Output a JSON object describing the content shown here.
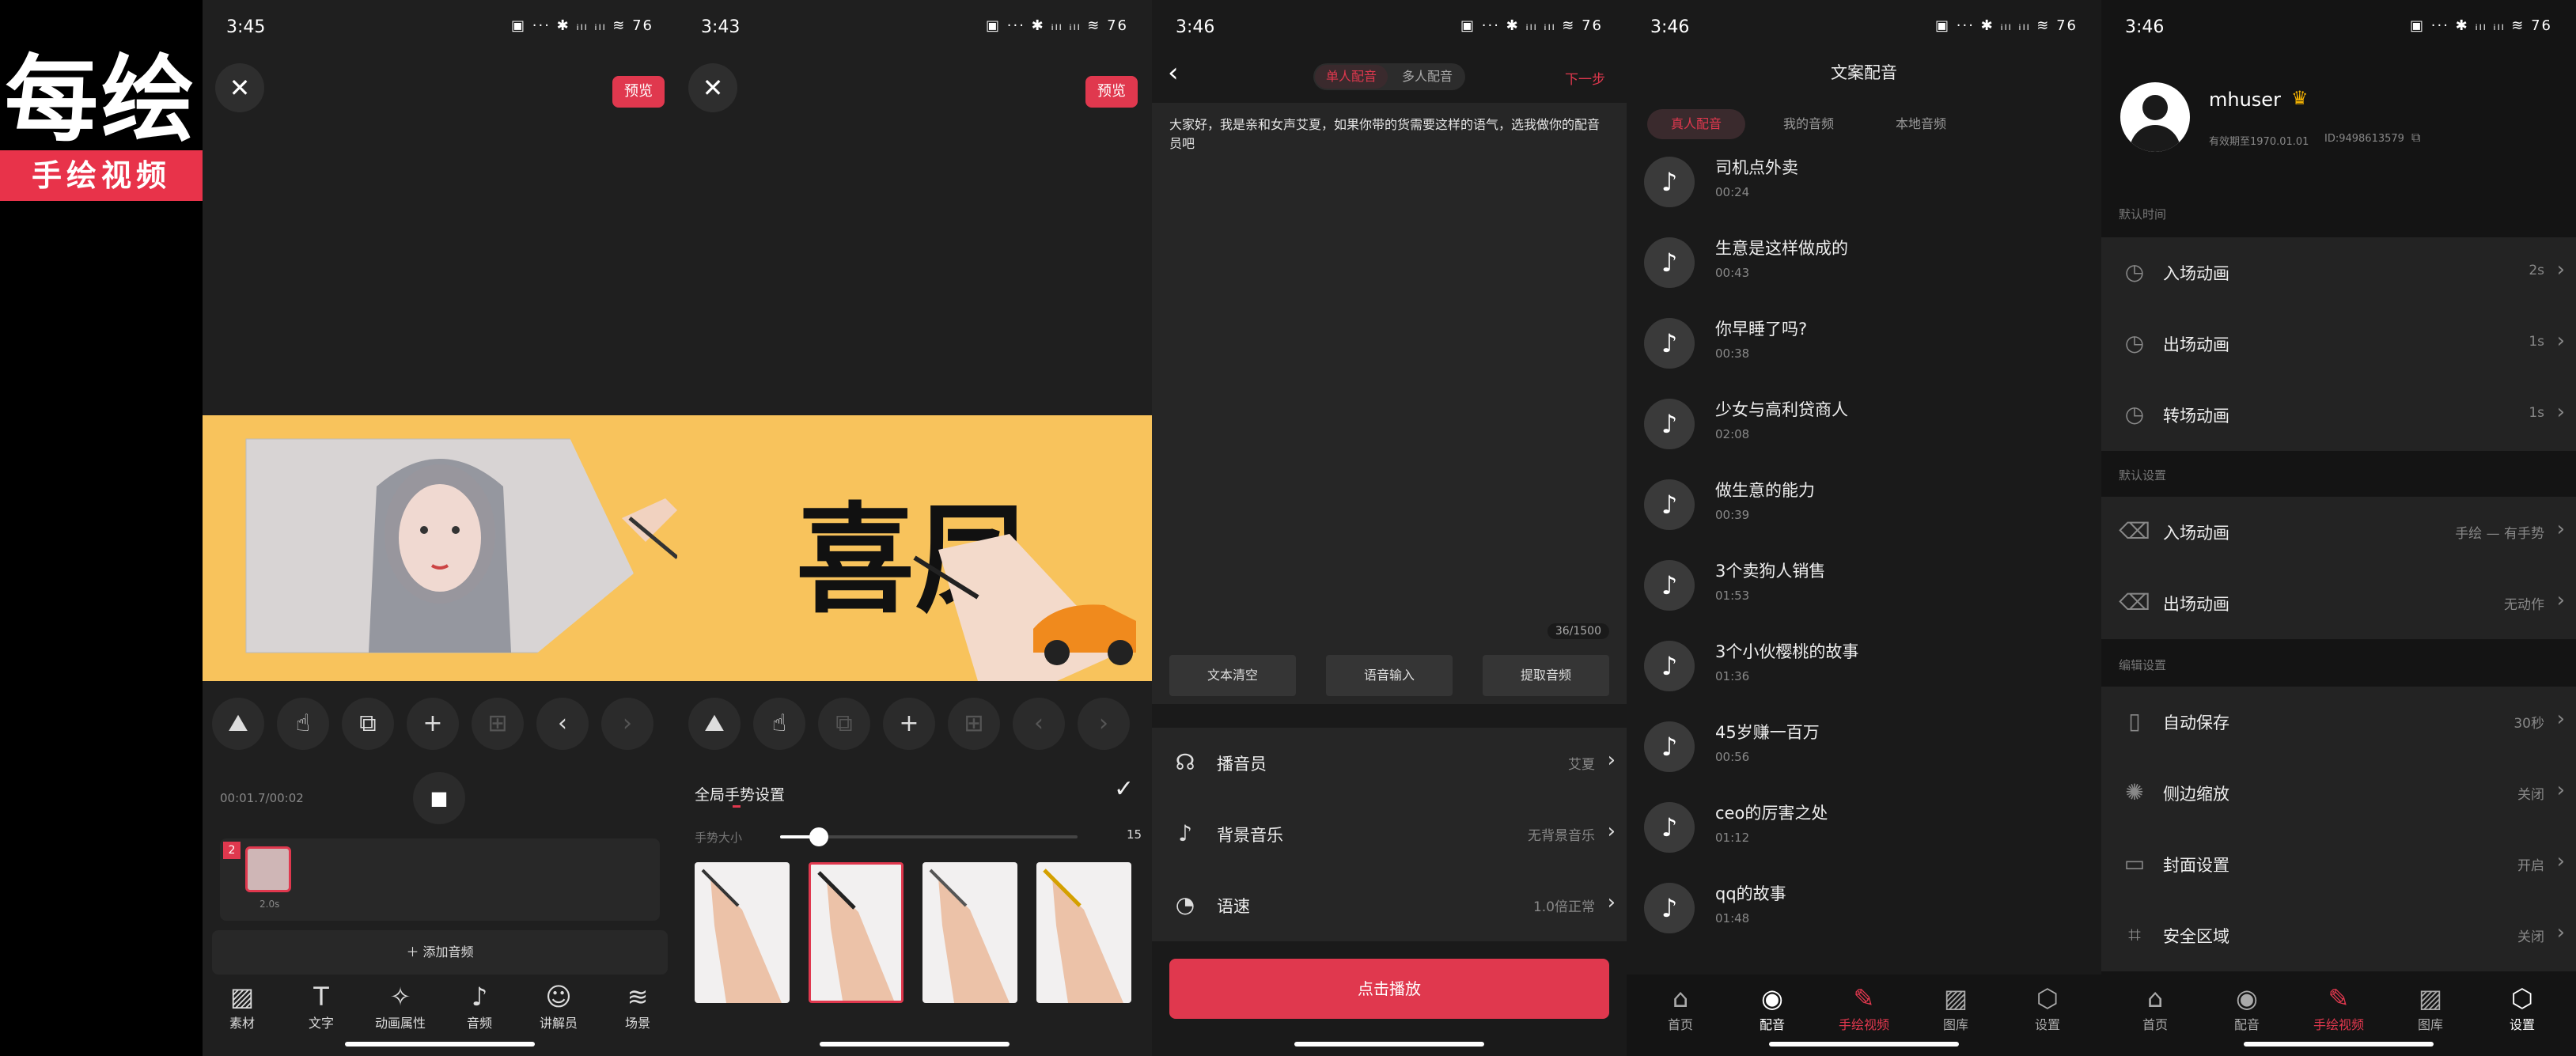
{
  "logo": {
    "main": "每绘",
    "band": "手绘视频"
  },
  "screen1": {
    "time": "3:45",
    "status_icons": "▣ ··· ✱ ᵢₗₗ ᵢₗₗ ≋ 76",
    "preview_label": "预览",
    "time_display": "00:01.7/00:02",
    "clip_badge": "2",
    "clip_duration": "2.0s",
    "add_audio_label": "添加音频",
    "bottom_tabs": [
      "素材",
      "文字",
      "动画属性",
      "音频",
      "讲解员",
      "场景"
    ]
  },
  "screen2": {
    "time": "3:43",
    "status_icons": "▣ ··· ✱ ᵢₗₗ ᵢₗₗ ≋ 76",
    "preview_label": "预览",
    "canvas_text": "喜凤",
    "gesture_title": "全局手势设置",
    "slider_label": "手势大小",
    "slider_value": "15",
    "slider_level": 0.13
  },
  "screen3": {
    "time": "3:46",
    "status_icons": "▣ ··· ✱ ᵢₗₗ ᵢₗₗ ≋ 76",
    "tabs": [
      "单人配音",
      "多人配音"
    ],
    "next_label": "下一步",
    "script_text": "大家好，我是亲和女声艾夏，如果你带的货需要这样的语气，选我做你的配音员吧",
    "char_count": "36/1500",
    "actions": [
      "文本清空",
      "语音输入",
      "提取音频"
    ],
    "settings": [
      {
        "label": "播音员",
        "value": "艾夏"
      },
      {
        "label": "背景音乐",
        "value": "无背景音乐"
      },
      {
        "label": "语速",
        "value": "1.0倍正常"
      }
    ],
    "play_label": "点击播放"
  },
  "screen4": {
    "time": "3:46",
    "status_icons": "▣ ··· ✱ ᵢₗₗ ᵢₗₗ ≋ 76",
    "title": "文案配音",
    "tabs": [
      "真人配音",
      "我的音频",
      "本地音频"
    ],
    "items": [
      {
        "title": "司机点外卖",
        "duration": "00:24"
      },
      {
        "title": "生意是这样做成的",
        "duration": "00:43"
      },
      {
        "title": "你早睡了吗?",
        "duration": "00:38"
      },
      {
        "title": "少女与高利贷商人",
        "duration": "02:08"
      },
      {
        "title": "做生意的能力",
        "duration": "00:39"
      },
      {
        "title": "3个卖狗人销售",
        "duration": "01:53"
      },
      {
        "title": "3个小伙樱桃的故事",
        "duration": "01:36"
      },
      {
        "title": "45岁赚一百万",
        "duration": "00:56"
      },
      {
        "title": "ceo的厉害之处",
        "duration": "01:12"
      },
      {
        "title": "qq的故事",
        "duration": "01:48"
      }
    ],
    "nav": [
      "首页",
      "配音",
      "手绘视频",
      "图库",
      "设置"
    ]
  },
  "screen5": {
    "time": "3:46",
    "status_icons": "▣ ··· ✱ ᵢₗₗ ᵢₗₗ ≋ 76",
    "username": "mhuser",
    "validity": "有效期至1970.01.01",
    "user_id": "ID:9498613579",
    "section1": "默认时间",
    "section2": "默认设置",
    "section3": "编辑设置",
    "rows": [
      {
        "label": "入场动画",
        "value": "2s"
      },
      {
        "label": "出场动画",
        "value": "1s"
      },
      {
        "label": "转场动画",
        "value": "1s"
      },
      {
        "label": "入场动画",
        "value": "手绘 — 有手势"
      },
      {
        "label": "出场动画",
        "value": "无动作"
      },
      {
        "label": "自动保存",
        "value": "30秒"
      },
      {
        "label": "侧边缩放",
        "value": "关闭"
      },
      {
        "label": "封面设置",
        "value": "开启"
      },
      {
        "label": "安全区域",
        "value": "关闭"
      }
    ],
    "nav": [
      "首页",
      "配音",
      "手绘视频",
      "图库",
      "设置"
    ]
  },
  "colors": {
    "accent": "#e0384e",
    "canvas": "#f8c35c",
    "bg": "#1f1f1f"
  }
}
